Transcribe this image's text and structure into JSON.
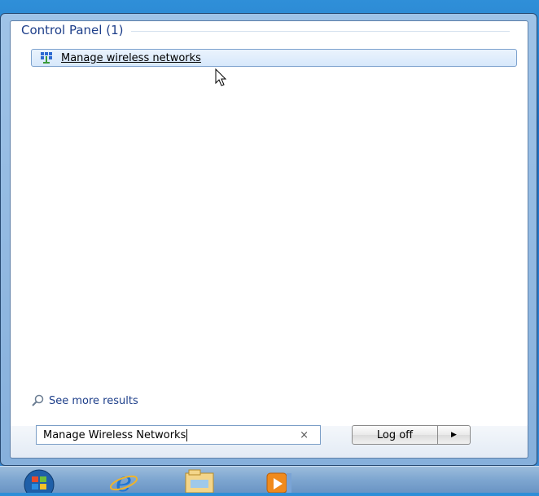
{
  "start_menu": {
    "group_header": "Control Panel (1)",
    "results": [
      {
        "label": "Manage wireless networks",
        "icon": "wireless-networks-icon"
      }
    ],
    "see_more_label": "See more results",
    "search": {
      "value": "Manage Wireless Networks",
      "clear_label": "×"
    },
    "log_off_label": "Log off",
    "log_off_arrow": "▶"
  },
  "taskbar": {
    "items": [
      {
        "name": "start-orb",
        "icon": "windows-logo-icon"
      },
      {
        "name": "internet-explorer",
        "icon": "internet-explorer-icon"
      },
      {
        "name": "windows-explorer",
        "icon": "folder-icon"
      },
      {
        "name": "media-player",
        "icon": "media-player-icon"
      }
    ]
  },
  "colors": {
    "header_text": "#1e3f8a",
    "selection_bg": "#d7e8fb",
    "selection_border": "#7da2ce"
  }
}
